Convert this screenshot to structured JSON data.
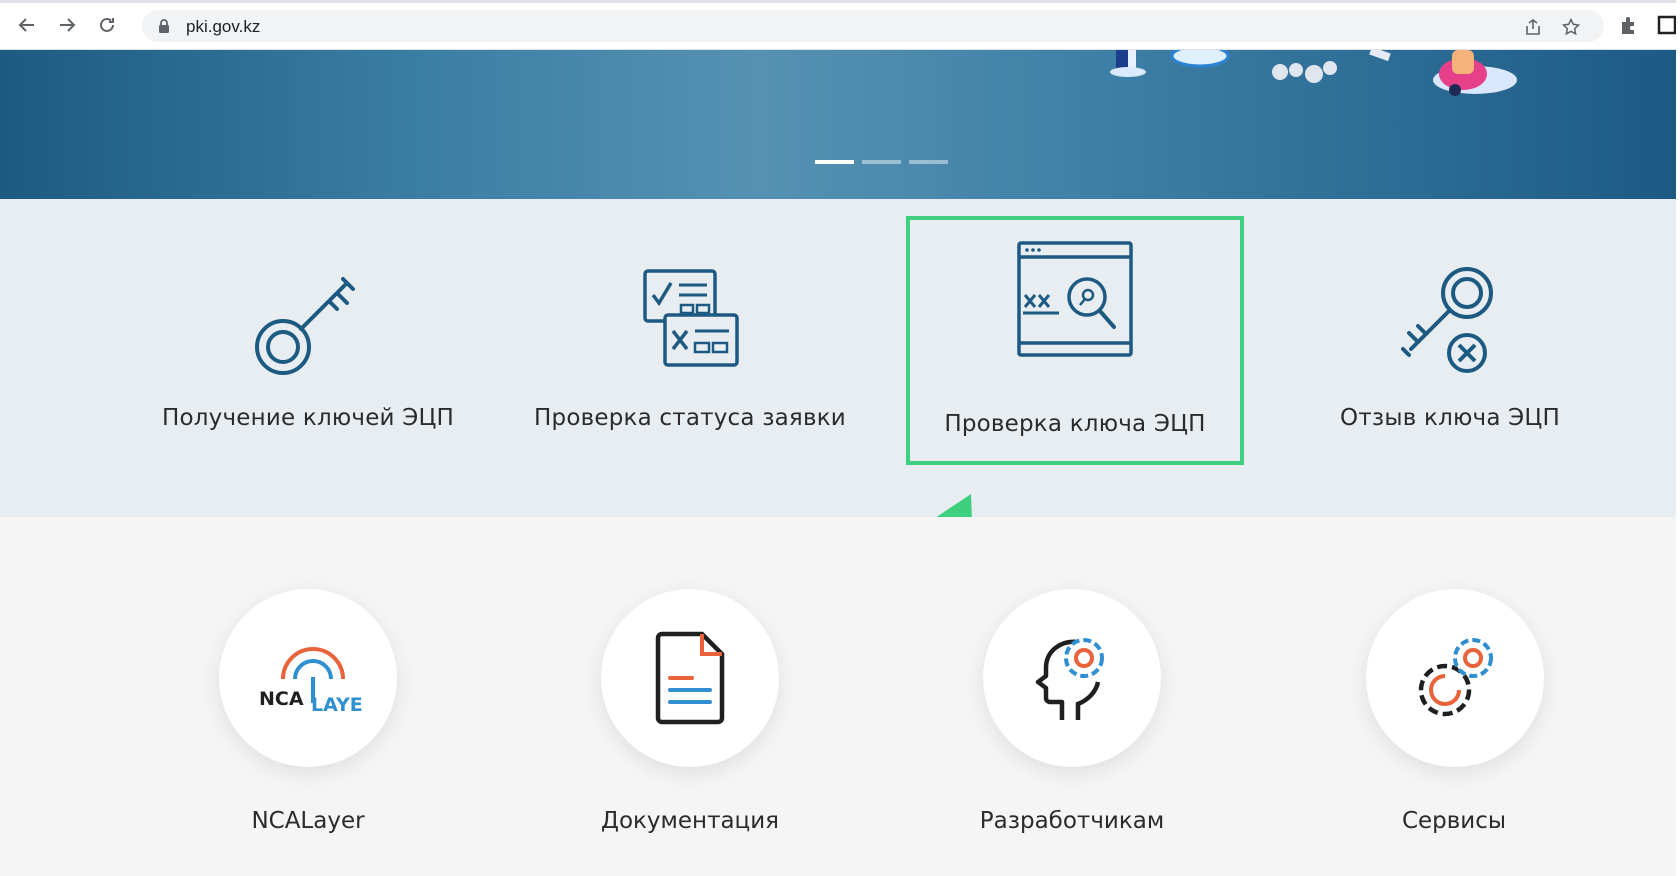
{
  "browser": {
    "url": "pki.gov.kz",
    "icons": [
      "back-arrow-icon",
      "forward-arrow-icon",
      "reload-icon",
      "lock-icon",
      "share-icon",
      "star-icon",
      "puzzle-icon",
      "window-icon"
    ]
  },
  "hero": {
    "slides_count": 3,
    "active_slide": 1
  },
  "services": [
    {
      "label": "Получение ключей ЭЦП",
      "icon": "key-icon"
    },
    {
      "label": "Проверка статуса заявки",
      "icon": "status-check-icon"
    },
    {
      "label": "Проверка ключа ЭЦП",
      "icon": "key-check-search-icon",
      "highlighted": true
    },
    {
      "label": "Отзыв ключа ЭЦП",
      "icon": "key-revoke-icon"
    }
  ],
  "resources": [
    {
      "label": "NCALayer",
      "icon": "ncalayer-logo",
      "logo_text_left": "NCA",
      "logo_text_right": "LAYER"
    },
    {
      "label": "Документация",
      "icon": "document-icon"
    },
    {
      "label": "Разработчикам",
      "icon": "developer-head-gear-icon"
    },
    {
      "label": "Сервисы",
      "icon": "gears-icon"
    }
  ],
  "colors": {
    "highlight": "#3fd07f",
    "icon_blue": "#1d5a82",
    "accent_orange": "#e8633a",
    "accent_blue": "#2f8fd0"
  }
}
